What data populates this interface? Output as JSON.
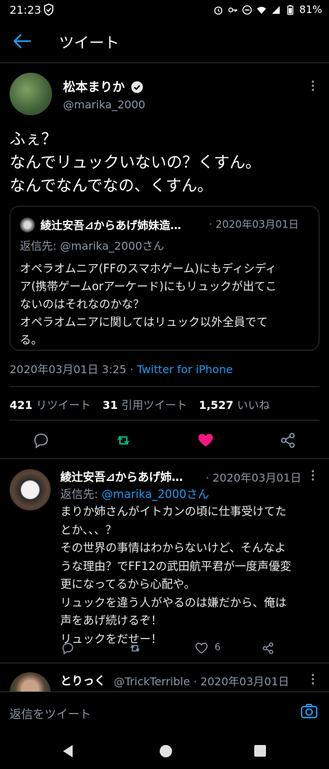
{
  "status_bar": {
    "time": "21:23",
    "battery": "81%"
  },
  "header": {
    "title": "ツイート"
  },
  "tweet": {
    "name": "松本まりか",
    "handle": "@marika_2000",
    "text_lines": [
      "ふぇ？",
      "なんでリュックいないの？くすん。",
      "なんでなんでなの、くすん。"
    ],
    "timestamp": "2020年03月01日 3:25",
    "source_sep": " · ",
    "source": "Twitter for iPhone"
  },
  "quote": {
    "name": "綾辻安吾⊿からあげ姉妹造…",
    "date": "· 2020年03月01日",
    "reply_to": "返信先: @marika_2000さん",
    "body_lines": [
      "オペラオムニア(FFのスマホゲーム)にもディシディ",
      "ア(携帯ゲームorアーケード)にもリュックが出てこ",
      "ないのはそれなのかな？",
      "オペラオムニアに関してはリュック以外全員でて",
      "る。"
    ]
  },
  "stats": {
    "retweets": "421",
    "retweets_label": "リツイート",
    "quotes": "31",
    "quotes_label": "引用ツイート",
    "likes": "1,527",
    "likes_label": "いいね"
  },
  "reply": {
    "name": "綾辻安吾⊿からあげ姉…",
    "date": "· 2020年03月01日",
    "reply_prefix": "返信先: ",
    "reply_mention": "@marika_2000さん",
    "body_lines": [
      "まりか姉さんがイトカンの頃に仕事受けてた",
      "とか、、、？",
      "その世界の事情はわからないけど、そんなよ",
      "うな理由？でFF12の武田航平君が一度声優変",
      "更になってるから心配や。",
      "リュックを違う人がやるのは嫌だから、俺は",
      "声をあげ続けるぞ！",
      "リュックをだせー！"
    ],
    "like_count": "6"
  },
  "third": {
    "name": "とりっく",
    "handle": "@TrickTerrible · 2020年03月01日"
  },
  "composer": {
    "placeholder": "返信をツイート"
  },
  "colors": {
    "accent": "#1d9bf0",
    "retweet": "#00ba7c",
    "like": "#f91880"
  }
}
